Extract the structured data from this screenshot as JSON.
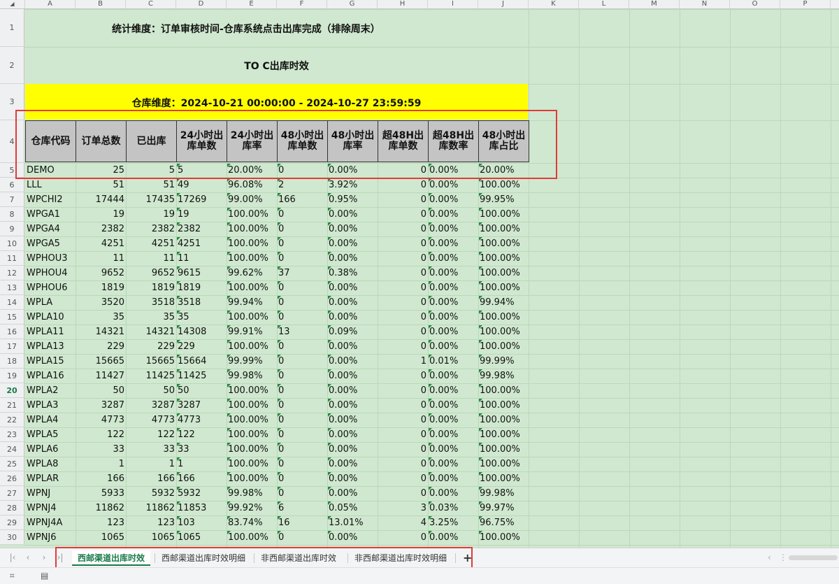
{
  "columns": [
    "A",
    "B",
    "C",
    "D",
    "E",
    "F",
    "G",
    "H",
    "I",
    "J",
    "K",
    "L",
    "M",
    "N",
    "O",
    "P"
  ],
  "title1": "统计维度：订单审核时间-仓库系统点击出库完成（排除周末）",
  "title2": "TO C出库时效",
  "title3": "仓库维度：2024-10-21 00:00:00 - 2024-10-27 23:59:59",
  "headers": [
    "仓库代码",
    "订单总数",
    "已出库",
    "24小时出库单数",
    "24小时出库率",
    "48小时出库单数",
    "48小时出库率",
    "超48H出库单数",
    "超48H出库数率",
    "48小时出库占比"
  ],
  "row_numbers": [
    "1",
    "2",
    "3",
    "4",
    "5",
    "6",
    "7",
    "8",
    "9",
    "10",
    "11",
    "12",
    "13",
    "14",
    "15",
    "16",
    "17",
    "18",
    "19",
    "20",
    "21",
    "22",
    "23",
    "24",
    "25",
    "26",
    "27",
    "28",
    "29",
    "30"
  ],
  "rows": [
    [
      "DEMO",
      "25",
      "5",
      "5",
      "20.00%",
      "0",
      "0.00%",
      "0",
      "0.00%",
      "20.00%"
    ],
    [
      "LLL",
      "51",
      "51",
      "49",
      "96.08%",
      "2",
      "3.92%",
      "0",
      "0.00%",
      "100.00%"
    ],
    [
      "WPCHI2",
      "17444",
      "17435",
      "17269",
      "99.00%",
      "166",
      "0.95%",
      "0",
      "0.00%",
      "99.95%"
    ],
    [
      "WPGA1",
      "19",
      "19",
      "19",
      "100.00%",
      "0",
      "0.00%",
      "0",
      "0.00%",
      "100.00%"
    ],
    [
      "WPGA4",
      "2382",
      "2382",
      "2382",
      "100.00%",
      "0",
      "0.00%",
      "0",
      "0.00%",
      "100.00%"
    ],
    [
      "WPGA5",
      "4251",
      "4251",
      "4251",
      "100.00%",
      "0",
      "0.00%",
      "0",
      "0.00%",
      "100.00%"
    ],
    [
      "WPHOU3",
      "11",
      "11",
      "11",
      "100.00%",
      "0",
      "0.00%",
      "0",
      "0.00%",
      "100.00%"
    ],
    [
      "WPHOU4",
      "9652",
      "9652",
      "9615",
      "99.62%",
      "37",
      "0.38%",
      "0",
      "0.00%",
      "100.00%"
    ],
    [
      "WPHOU6",
      "1819",
      "1819",
      "1819",
      "100.00%",
      "0",
      "0.00%",
      "0",
      "0.00%",
      "100.00%"
    ],
    [
      "WPLA",
      "3520",
      "3518",
      "3518",
      "99.94%",
      "0",
      "0.00%",
      "0",
      "0.00%",
      "99.94%"
    ],
    [
      "WPLA10",
      "35",
      "35",
      "35",
      "100.00%",
      "0",
      "0.00%",
      "0",
      "0.00%",
      "100.00%"
    ],
    [
      "WPLA11",
      "14321",
      "14321",
      "14308",
      "99.91%",
      "13",
      "0.09%",
      "0",
      "0.00%",
      "100.00%"
    ],
    [
      "WPLA13",
      "229",
      "229",
      "229",
      "100.00%",
      "0",
      "0.00%",
      "0",
      "0.00%",
      "100.00%"
    ],
    [
      "WPLA15",
      "15665",
      "15665",
      "15664",
      "99.99%",
      "0",
      "0.00%",
      "1",
      "0.01%",
      "99.99%"
    ],
    [
      "WPLA16",
      "11427",
      "11425",
      "11425",
      "99.98%",
      "0",
      "0.00%",
      "0",
      "0.00%",
      "99.98%"
    ],
    [
      "WPLA2",
      "50",
      "50",
      "50",
      "100.00%",
      "0",
      "0.00%",
      "0",
      "0.00%",
      "100.00%"
    ],
    [
      "WPLA3",
      "3287",
      "3287",
      "3287",
      "100.00%",
      "0",
      "0.00%",
      "0",
      "0.00%",
      "100.00%"
    ],
    [
      "WPLA4",
      "4773",
      "4773",
      "4773",
      "100.00%",
      "0",
      "0.00%",
      "0",
      "0.00%",
      "100.00%"
    ],
    [
      "WPLA5",
      "122",
      "122",
      "122",
      "100.00%",
      "0",
      "0.00%",
      "0",
      "0.00%",
      "100.00%"
    ],
    [
      "WPLA6",
      "33",
      "33",
      "33",
      "100.00%",
      "0",
      "0.00%",
      "0",
      "0.00%",
      "100.00%"
    ],
    [
      "WPLA8",
      "1",
      "1",
      "1",
      "100.00%",
      "0",
      "0.00%",
      "0",
      "0.00%",
      "100.00%"
    ],
    [
      "WPLAR",
      "166",
      "166",
      "166",
      "100.00%",
      "0",
      "0.00%",
      "0",
      "0.00%",
      "100.00%"
    ],
    [
      "WPNJ",
      "5933",
      "5932",
      "5932",
      "99.98%",
      "0",
      "0.00%",
      "0",
      "0.00%",
      "99.98%"
    ],
    [
      "WPNJ4",
      "11862",
      "11862",
      "11853",
      "99.92%",
      "6",
      "0.05%",
      "3",
      "0.03%",
      "99.97%"
    ],
    [
      "WPNJ4A",
      "123",
      "123",
      "103",
      "83.74%",
      "16",
      "13.01%",
      "4",
      "3.25%",
      "96.75%"
    ],
    [
      "WPNJ6",
      "1065",
      "1065",
      "1065",
      "100.00%",
      "0",
      "0.00%",
      "0",
      "0.00%",
      "100.00%"
    ]
  ],
  "active_row": "20",
  "sheet_tabs": [
    "西邮渠道出库时效",
    "西邮渠道出库时效明细",
    "非西邮渠道出库时效",
    "非西邮渠道出库时效明细"
  ],
  "active_tab": 0,
  "add_tab_label": "+",
  "colors": {
    "sheet_bg": "#cfe8cf",
    "title_band": "#ffff00",
    "header_bg": "#c4c4c4",
    "highlight_box": "#e13b3b",
    "active_tab": "#1a7a4a"
  }
}
